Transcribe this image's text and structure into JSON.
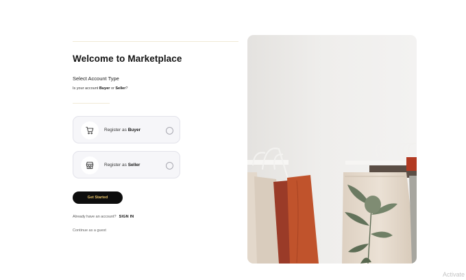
{
  "page": {
    "title": "Welcome to Marketplace",
    "subtitle": "Select Account Type",
    "question": {
      "prefix": "Is your account ",
      "buyer": "Buyer",
      "middle": " or ",
      "seller": "Seller",
      "suffix": "?"
    }
  },
  "accounts": [
    {
      "prefix": "Register as ",
      "role": "Buyer",
      "icon": "shopping-cart-icon",
      "selected": false
    },
    {
      "prefix": "Register as ",
      "role": "Seller",
      "icon": "storefront-icon",
      "selected": false
    }
  ],
  "cta": {
    "label": "Get Started"
  },
  "signin": {
    "prompt": "Already have an account?",
    "link": "SIGN IN"
  },
  "guest": {
    "label": "Continue as a guest"
  },
  "hero": {
    "image": "clothing-rack-photo"
  },
  "watermark": {
    "text": "Activate"
  },
  "colors": {
    "accent": "#e9c46a",
    "cta_bg": "#0d0d0d",
    "card_bg": "#f6f6f9",
    "divider": "#f1ead6"
  }
}
